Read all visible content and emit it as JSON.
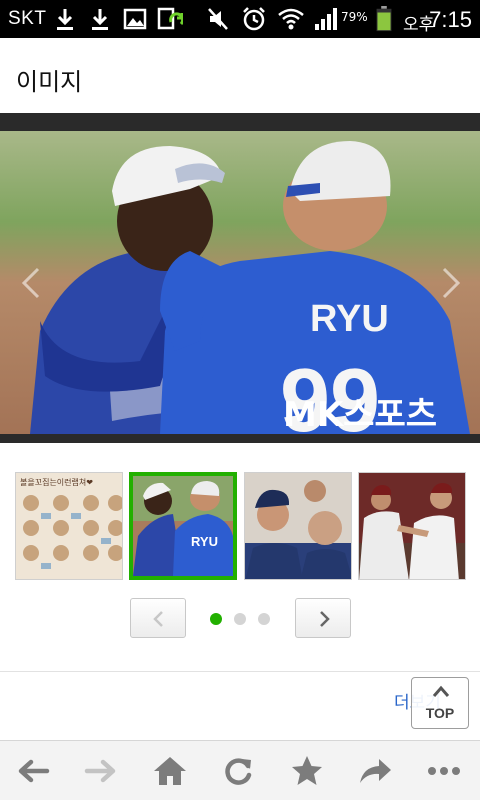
{
  "status_bar": {
    "carrier": "SKT",
    "battery_percent": "79%",
    "ampm": "오후",
    "time": "7:15",
    "icons": [
      "download-icon",
      "download-icon",
      "image-icon",
      "sync-icon",
      "mute-icon",
      "alarm-icon",
      "wifi-icon",
      "signal-icon",
      "battery-icon"
    ],
    "battery_color": "#8cc63f"
  },
  "page": {
    "title": "이미지"
  },
  "main_image": {
    "jersey_name": "RYU",
    "jersey_number": "99",
    "watermark": "MK스포츠",
    "prev_icon": "chevron-left-icon",
    "next_icon": "chevron-right-icon"
  },
  "thumbnails": [
    {
      "caption": "볼을꼬집는이런랩쳐❤",
      "selected": false
    },
    {
      "caption": "RYU",
      "selected": true
    },
    {
      "caption": "",
      "selected": false
    },
    {
      "caption": "",
      "selected": false
    }
  ],
  "pager": {
    "prev_icon": "chevron-left-icon",
    "next_icon": "chevron-right-icon",
    "dots": 3,
    "active_dot": 0,
    "active_color": "#22b000"
  },
  "footer": {
    "more_label": "더보기",
    "top_label": "TOP",
    "top_icon": "chevron-up-icon"
  },
  "toolbar": {
    "buttons": [
      "back-icon",
      "forward-icon",
      "home-icon",
      "refresh-icon",
      "bookmark-icon",
      "share-icon",
      "more-icon"
    ]
  }
}
